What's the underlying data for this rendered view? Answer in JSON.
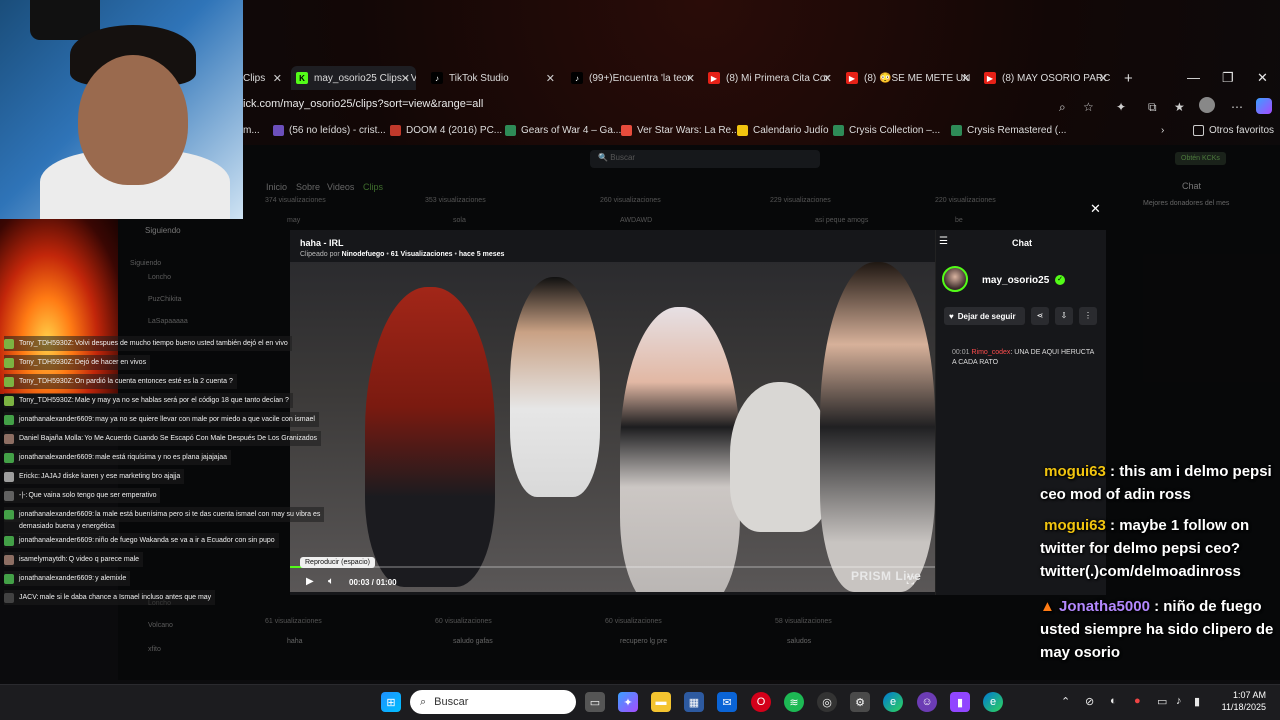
{
  "browser": {
    "tabs": [
      {
        "label": "Clips",
        "icon": "kick-icon"
      },
      {
        "label": "may_osorio25 Clips - V",
        "icon": "kick-icon"
      },
      {
        "label": "TikTok Studio",
        "icon": "tiktok-icon"
      },
      {
        "label": "(99+)Encuentra 'la teor",
        "icon": "tiktok-icon"
      },
      {
        "label": "(8) Mi Primera Cita Cor",
        "icon": "youtube-icon"
      },
      {
        "label": "(8) 😳SE ME METE UN",
        "icon": "youtube-icon"
      },
      {
        "label": "(8) MAY OSORIO PARC",
        "icon": "youtube-icon"
      }
    ],
    "new_tab": "+",
    "url": "ick.com/may_osorio25/clips?sort=view&range=all",
    "bookmarks": [
      {
        "label": "m...",
        "color": "#888888"
      },
      {
        "label": "(56 no leídos) - crist...",
        "color": "#6b4fbb"
      },
      {
        "label": "DOOM 4 (2016) PC...",
        "color": "#c0392b"
      },
      {
        "label": "Gears of War 4 – Ga...",
        "color": "#2e8b57"
      },
      {
        "label": "Ver Star Wars: La Re...",
        "color": "#e74c3c"
      },
      {
        "label": "Calendario Judío",
        "color": "#f1c40f"
      },
      {
        "label": "Crysis Collection –...",
        "color": "#2e8b57"
      },
      {
        "label": "Crysis Remastered (...",
        "color": "#2e8b57"
      }
    ],
    "other_favorites": "Otros favoritos"
  },
  "kick": {
    "search_placeholder": "Buscar",
    "earn_label": "Obtén KCKs",
    "nav": [
      "Inicio",
      "Sobre",
      "Videos",
      "Clips"
    ],
    "following_label": "Siguiendo",
    "following_header": "Siguiendo",
    "sidebar_names": [
      "Loncho",
      "PuzChikita",
      "LaSapaaaaa",
      "Loncho",
      "Volcano",
      "xfito"
    ],
    "top_cards": [
      "374 visualizaciones",
      "353 visualizaciones",
      "260 visualizaciones",
      "229 visualizaciones",
      "220 visualizaciones"
    ],
    "top_titles": [
      "may",
      "sola",
      "AWDAWD",
      "asi peque amogs",
      "be"
    ],
    "bottom_cards": [
      "61 visualizaciones",
      "60 visualizaciones",
      "60 visualizaciones",
      "58 visualizaciones"
    ],
    "bottom_titles": [
      "haha",
      "saludo gafas",
      "recupero lg pre",
      "saludos"
    ],
    "right_title": "Chat",
    "right_subtitle": "Mejores donadores del mes"
  },
  "modal": {
    "title": "haha - IRL",
    "clipped_by_label": "Clipeado por",
    "clipped_by": "Ninodefuego",
    "views": "61 Visualizaciones",
    "age": "hace 5 meses",
    "tooltip": "Reproducir (espacio)",
    "timecode": "00:03 / 01:00",
    "progress_fraction": 0.05,
    "watermark": "PRISM Live",
    "chat_title": "Chat",
    "channel": "may_osorio25",
    "unfollow": "Dejar de seguir",
    "message": {
      "time": "00:01",
      "user": "Rimo_codex",
      "text": ": UNA DE AQUI HERUCTA A CADA RATO"
    }
  },
  "overlay_chat": [
    {
      "user": "Tony_TDH5930Z:",
      "text": " Volvi despues de mucho tiempo bueno usted también dejó el en vivo",
      "color": "#7cb342"
    },
    {
      "user": "Tony_TDH5930Z:",
      "text": " Dejó de hacer en vivos",
      "color": "#7cb342"
    },
    {
      "user": "Tony_TDH5930Z:",
      "text": " On pardió la cuenta entonces esté es la 2 cuenta ?",
      "color": "#7cb342"
    },
    {
      "user": "Tony_TDH5930Z:",
      "text": " Male y may ya no se hablas será por el código 18 que tanto decían ?",
      "color": "#7cb342"
    },
    {
      "user": "jonathanalexander6609:",
      "text": " may ya no se quiere llevar con male por miedo a que vacile con ismael",
      "color": "#43a047"
    },
    {
      "user": "Daniel Bajaña Molla:",
      "text": " Yo Me Acuerdo Cuando Se Escapó Con Male Después De Los Granizados",
      "color": "#8d6e63"
    },
    {
      "user": "jonathanalexander6609:",
      "text": " male está riquísima y no es plana jajajajaa",
      "color": "#43a047"
    },
    {
      "user": "Erickc:",
      "text": " JAJAJ diske karen y ese marketing bro ajajja",
      "color": "#9e9e9e"
    },
    {
      "user": "-|-:",
      "text": " Que vaina solo tengo que ser emperativo",
      "color": "#616161"
    },
    {
      "user": "jonathanalexander6609:",
      "text": " la male está buenísima pero si te das cuenta ismael con may su vibra es",
      "color": "#43a047"
    },
    {
      "user": "",
      "text": "demasiado buena y energética",
      "color": ""
    },
    {
      "user": "jonathanalexander6609:",
      "text": " niño de fuego Wakanda se va a ir a Ecuador con sin pupo",
      "color": "#43a047"
    },
    {
      "user": "isamelymaytdh:",
      "text": " Q video q parece male",
      "color": "#8d6e63"
    },
    {
      "user": "jonathanalexander6609:",
      "text": " y alemixle",
      "color": "#43a047"
    },
    {
      "user": "JACV:",
      "text": " male si le daba chance a Ismael incluso antes que may",
      "color": "#424242"
    }
  ],
  "big_chat": [
    {
      "user": "mogui63",
      "text": " : this am i delmo pepsi ceo mod of adin ross"
    },
    {
      "user": "mogui63",
      "text": " : maybe 1 follow on twitter for delmo pepsi ceo? twitter(.)com/delmoadinross"
    },
    {
      "user": "Jonatha5000",
      "text": " : niño de fuego usted siempre ha sido clipero de may osorio"
    }
  ],
  "taskbar": {
    "search_placeholder": "Buscar",
    "time": "1:07 AM",
    "date": "11/18/2025"
  }
}
